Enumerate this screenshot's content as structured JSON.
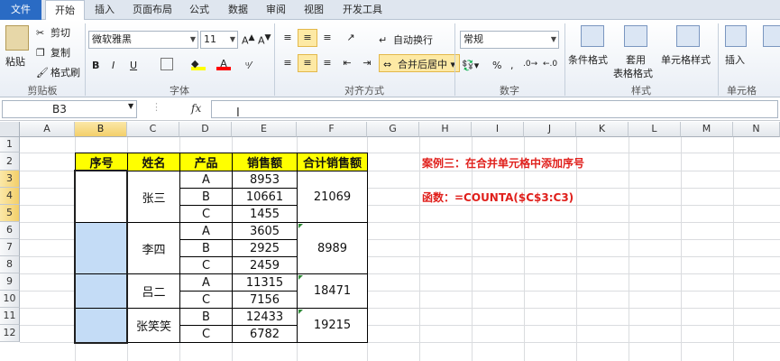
{
  "tabs": [
    "文件",
    "开始",
    "插入",
    "页面布局",
    "公式",
    "数据",
    "审阅",
    "视图",
    "开发工具"
  ],
  "ribbon": {
    "clipboard": {
      "paste": "粘贴",
      "cut": "剪切",
      "copy": "复制",
      "format_painter": "格式刷",
      "group": "剪贴板"
    },
    "font": {
      "name": "微软雅黑",
      "size": "11",
      "bold": "B",
      "italic": "I",
      "underline": "U",
      "group": "字体",
      "font_color": "#ff0000",
      "fill_color": "#ffff00"
    },
    "align": {
      "wrap": "自动换行",
      "merge": "合并后居中",
      "group": "对齐方式"
    },
    "number": {
      "format": "常规",
      "group": "数字"
    },
    "styles": {
      "cond": "条件格式",
      "table1": "套用",
      "table2": "表格格式",
      "cell": "单元格样式",
      "group": "样式"
    },
    "cells": {
      "insert": "插入",
      "group": "单元格"
    }
  },
  "formula_bar": {
    "name_box": "B3",
    "fx": "fx",
    "content": ""
  },
  "columns": [
    "A",
    "B",
    "C",
    "D",
    "E",
    "F",
    "G",
    "H",
    "I",
    "J",
    "K",
    "L",
    "M",
    "N"
  ],
  "rows": [
    "1",
    "2",
    "3",
    "4",
    "5",
    "6",
    "7",
    "8",
    "9",
    "10",
    "11",
    "12"
  ],
  "table": {
    "headers": [
      "序号",
      "姓名",
      "产品",
      "销售额",
      "合计销售额"
    ],
    "groups": [
      {
        "name": "张三",
        "items": [
          {
            "product": "A",
            "sales": "8953"
          },
          {
            "product": "B",
            "sales": "10661"
          },
          {
            "product": "C",
            "sales": "1455"
          }
        ],
        "total": "21069"
      },
      {
        "name": "李四",
        "items": [
          {
            "product": "A",
            "sales": "3605"
          },
          {
            "product": "B",
            "sales": "2925"
          },
          {
            "product": "C",
            "sales": "2459"
          }
        ],
        "total": "8989"
      },
      {
        "name": "吕二",
        "items": [
          {
            "product": "A",
            "sales": "11315"
          },
          {
            "product": "C",
            "sales": "7156"
          }
        ],
        "total": "18471"
      },
      {
        "name": "张笑笑",
        "items": [
          {
            "product": "B",
            "sales": "12433"
          },
          {
            "product": "C",
            "sales": "6782"
          }
        ],
        "total": "19215"
      }
    ]
  },
  "notes": {
    "title": "案例三：在合并单元格中添加序号",
    "formula": "函数：=COUNTA($C$3:C3)"
  },
  "colors": {
    "header_fill": "#ffff00",
    "selection_fill": "#c4dcf6",
    "note_color": "#e0201c",
    "file_tab": "#2a6bc4"
  }
}
